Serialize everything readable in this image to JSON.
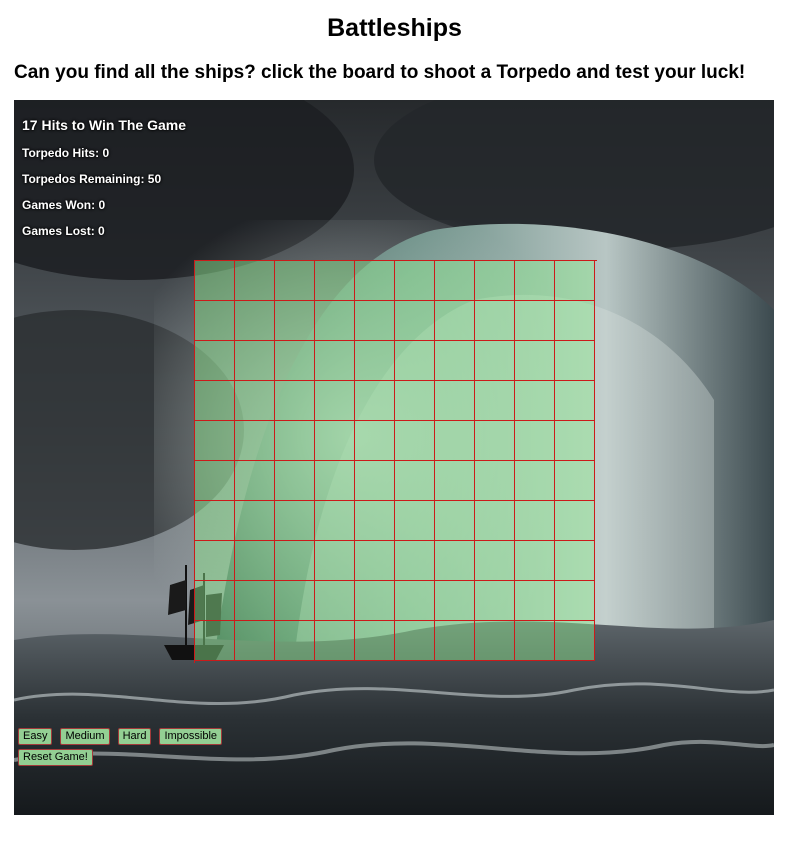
{
  "page": {
    "title": "Battleships",
    "subtitle": "Can you find all the ships? click the board to shoot a Torpedo and test your luck!"
  },
  "stats": {
    "goal": "17 Hits to Win The Game",
    "hits": "Torpedo Hits: 0",
    "remaining": "Torpedos Remaining: 50",
    "won": "Games Won: 0",
    "lost": "Games Lost: 0"
  },
  "board": {
    "rows": 10,
    "cols": 10,
    "cell_color": "#90ee90",
    "grid_color": "#cc1a1a"
  },
  "controls": {
    "difficulty": [
      "Easy",
      "Medium",
      "Hard",
      "Impossible"
    ],
    "reset_label": "Reset Game!"
  },
  "colors": {
    "button_bg": "#93cf93",
    "button_border": "#a23a3a"
  }
}
